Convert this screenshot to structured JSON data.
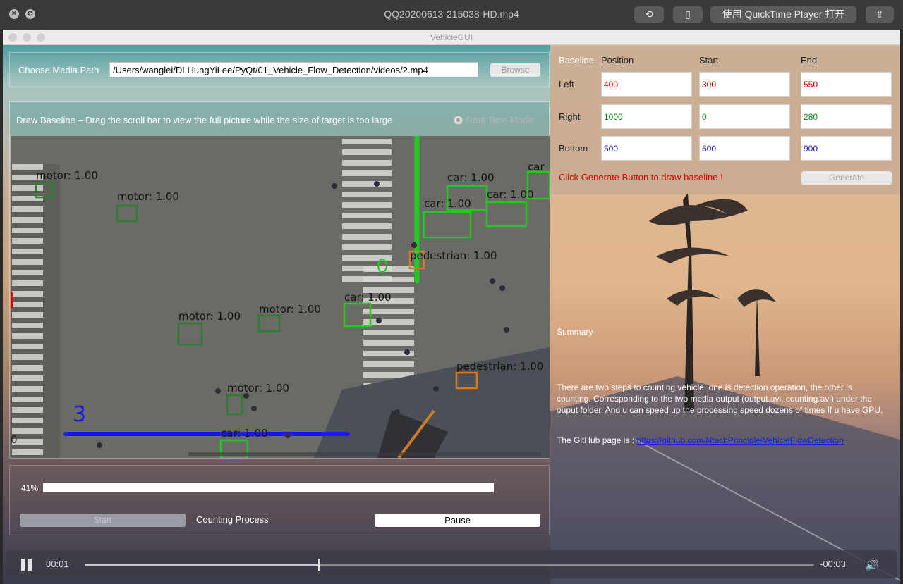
{
  "qt": {
    "title": "QQ20200613-215038-HD.mp4",
    "open_with_label": "使用 QuickTime Player 打开"
  },
  "window": {
    "title": "VehicleGUI"
  },
  "media": {
    "label": "Choose Media Path",
    "path": "/Users/wanglei/DLHungYiLee/PyQt/01_Vehicle_Flow_Detection/videos/2.mp4",
    "browse": "Browse"
  },
  "draw": {
    "label": "Draw Baseline  – Drag the scroll bar to view the full picture while the size of target is too large",
    "realtime": "Real Time Mode"
  },
  "video": {
    "detections": [
      {
        "label": "motor: 1.00"
      },
      {
        "label": "motor: 1.00"
      },
      {
        "label": "car: 1.00"
      },
      {
        "label": "car: 1.00"
      },
      {
        "label": "car: 1.00"
      },
      {
        "label": "car"
      },
      {
        "label": "pedestrian: 1.00"
      },
      {
        "label": "motor: 1.00"
      },
      {
        "label": "motor: 1.00"
      },
      {
        "label": "car: 1.00"
      },
      {
        "label": "pedestrian: 1.00"
      },
      {
        "label": "motor: 1.00"
      },
      {
        "label": "car: 1.00"
      }
    ],
    "count": "3"
  },
  "progress": {
    "percent_text": "41%",
    "value": 0.41,
    "start": "Start",
    "process_label": "Counting Process",
    "pause": "Pause"
  },
  "baseline": {
    "header": "Baseline",
    "col_position": "Position",
    "col_start": "Start",
    "col_end": "End",
    "rows": [
      {
        "label": "Left",
        "position": "400",
        "start": "300",
        "end": "550",
        "color": "#d40000"
      },
      {
        "label": "Right",
        "position": "1000",
        "start": "0",
        "end": "280",
        "color": "#0a8a0a"
      },
      {
        "label": "Bottom",
        "position": "500",
        "start": "500",
        "end": "900",
        "color": "#1a1ab8"
      }
    ],
    "hint": "Click Generate Button to draw baseline !",
    "generate": "Generate"
  },
  "summary": {
    "title": "Summary",
    "text": "There are two steps to counting vehicle. one is detection operation, the other is counting. Corresponding to the two media output (output.avi, counting.avi) under the ouput folder. And u can speed up the processing speed dozens of times If u have GPU.",
    "github_prefix": "The GitHub page is : ",
    "github_link": "https://github.com/NtechPrinciple/VehicleFlowDetection"
  },
  "player": {
    "elapsed": "00:01",
    "remaining": "-00:03",
    "position": 0.32
  },
  "colors": {
    "accent_red": "#d40000",
    "detection_green": "#1ecc1e",
    "baseline_blue": "#1a1ae6"
  }
}
